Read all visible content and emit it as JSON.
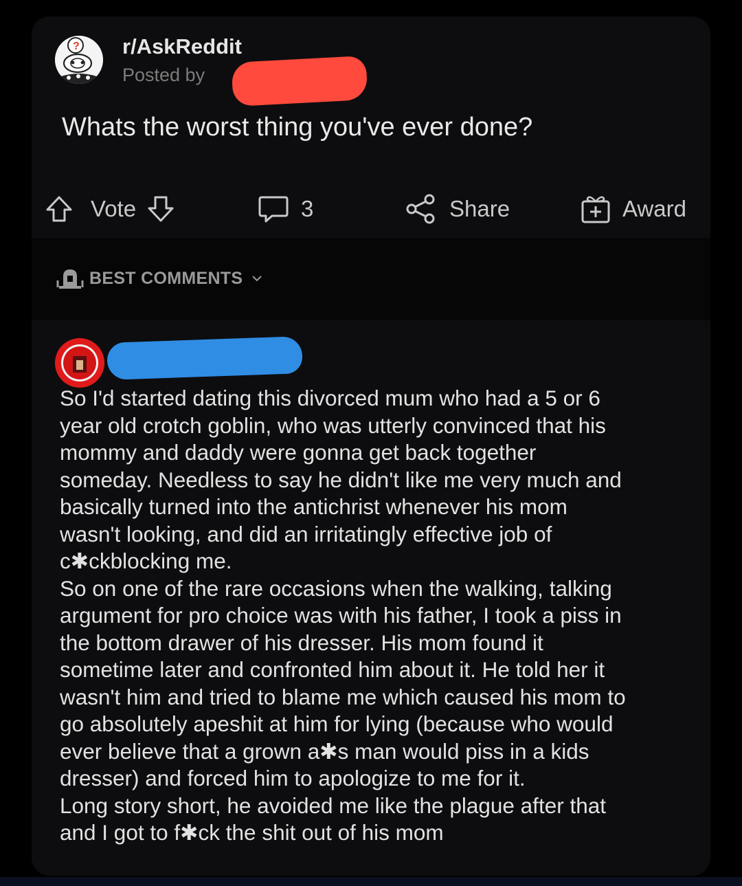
{
  "post": {
    "subreddit": "r/AskReddit",
    "posted_by": "Posted by",
    "title": "Whats the worst thing you've ever done?"
  },
  "actions": {
    "vote_label": "Vote",
    "comment_count": "3",
    "share_label": "Share",
    "award_label": "Award"
  },
  "sort": {
    "label": "BEST COMMENTS"
  },
  "comment": {
    "lines": [
      "So I'd started dating this divorced mum who had a 5 or 6",
      "year old crotch goblin, who was utterly convinced that his",
      "mommy and daddy were gonna get back together",
      "someday. Needless to say he didn't like me very much and",
      "basically turned into the antichrist whenever his mom",
      "wasn't looking, and did an irritatingly effective job of",
      "c✱ckblocking me.",
      "So on one of the rare occasions when the walking, talking",
      "argument for pro choice was with his father, I took a piss in",
      "the bottom drawer of his dresser. His mom found it",
      "sometime later and confronted him about it. He told her it",
      "wasn't him and tried to blame me which caused his mom to",
      "go absolutely apeshit at him for lying (because who would",
      "ever believe that a grown a✱s man would piss in a kids",
      "dresser) and forced him to apologize to me for it.",
      "Long story short, he avoided me like the plague after that",
      "and I got to f✱ck the shit out of his mom"
    ]
  },
  "colors": {
    "card_background": "#0d0d0f",
    "redaction_red": "#ff4a3d",
    "redaction_blue": "#2f8de4",
    "comment_avatar": "#e01b1b"
  },
  "icons": [
    "subreddit-avatar-icon",
    "upvote-icon",
    "downvote-icon",
    "comment-icon",
    "share-icon",
    "award-icon",
    "sort-icon",
    "chevron-down-icon",
    "comment-avatar-icon"
  ]
}
